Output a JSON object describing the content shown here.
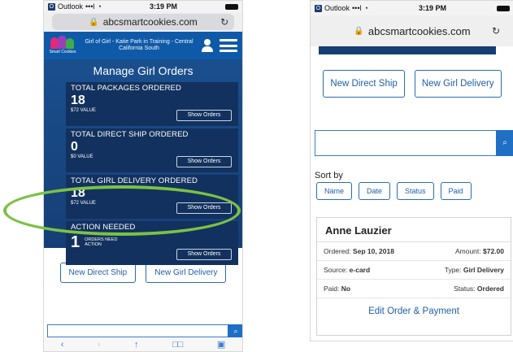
{
  "left": {
    "status": {
      "carrier": "Outlook",
      "signal": "•••l",
      "wifi": "◔",
      "time": "3:19 PM"
    },
    "address": {
      "lock": "🔒",
      "url": "abcsmartcookies.com",
      "reload": "↻"
    },
    "logo_text": "Smart Cookies",
    "troop": "Girl of Girl - Katie Park in Training - Central California South",
    "page_title": "Manage Girl Orders",
    "cards": [
      {
        "label": "TOTAL PACKAGES ORDERED",
        "number": "18",
        "value": "$72 VALUE",
        "button": "Show Orders"
      },
      {
        "label": "TOTAL DIRECT SHIP ORDERED",
        "number": "0",
        "value": "$0 VALUE",
        "button": "Show Orders"
      },
      {
        "label": "TOTAL GIRL DELIVERY ORDERED",
        "number": "18",
        "value": "$72 VALUE",
        "button": "Show Orders"
      },
      {
        "label": "ACTION NEEDED",
        "number": "1",
        "value": "ORDERS NEED ACTION",
        "button": "Show Orders"
      }
    ],
    "buttons": {
      "direct_ship": "New Direct Ship",
      "girl_delivery": "New Girl Delivery"
    },
    "search_icon": "⌕",
    "toolbar": {
      "back": "‹",
      "forward": "›",
      "share": "↑",
      "bookmarks": "□□",
      "tabs": "▣"
    }
  },
  "right": {
    "status": {
      "carrier": "Outlook",
      "signal": "•••l",
      "wifi": "◔",
      "time": "3:19 PM"
    },
    "address": {
      "lock": "🔒",
      "url": "abcsmartcookies.com",
      "reload": "↻"
    },
    "buttons": {
      "direct_ship": "New Direct Ship",
      "girl_delivery": "New Girl Delivery"
    },
    "search_icon": "⌕",
    "sort_label": "Sort by",
    "sort_options": [
      "Name",
      "Date",
      "Status",
      "Paid"
    ],
    "order": {
      "name": "Anne Lauzier",
      "ordered_label": "Ordered:",
      "ordered_value": "Sep 10, 2018",
      "amount_label": "Amount:",
      "amount_value": "$72.00",
      "source_label": "Source:",
      "source_value": "e-card",
      "type_label": "Type:",
      "type_value": "Girl Delivery",
      "paid_label": "Paid:",
      "paid_value": "No",
      "status_label": "Status:",
      "status_value": "Ordered",
      "edit": "Edit Order & Payment"
    }
  }
}
